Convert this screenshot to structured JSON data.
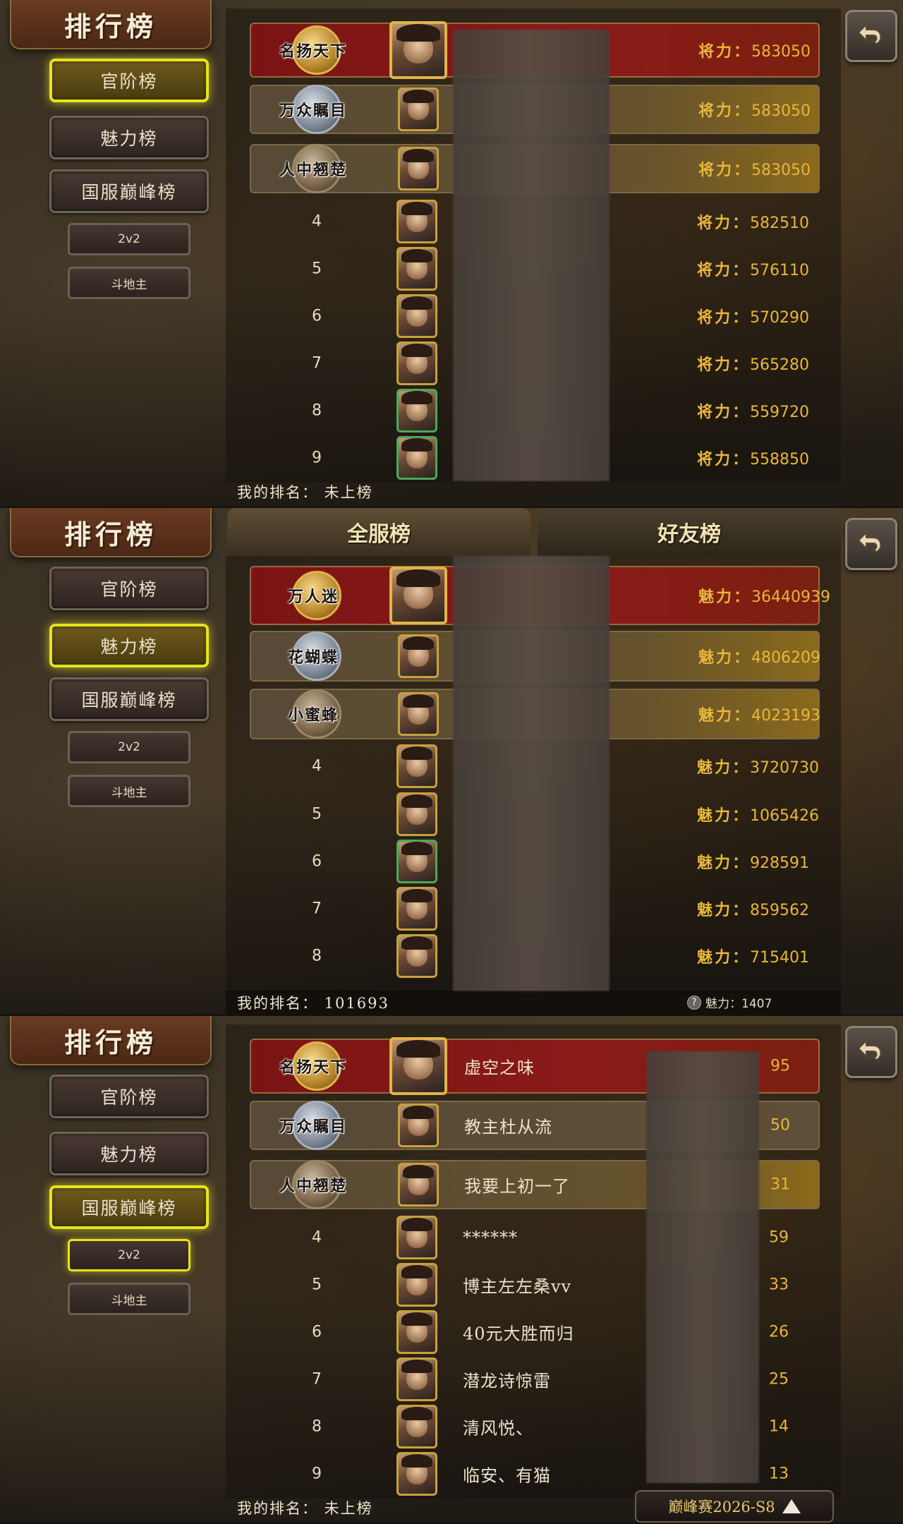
{
  "screen_title": "排行榜",
  "menu": {
    "official": "官阶榜",
    "charm": "魅力榜",
    "peak": "国服巅峰榜",
    "sub_2v2": "2v2",
    "sub_ddz": "斗地主"
  },
  "tabs": {
    "server": "全服榜",
    "friends": "好友榜"
  },
  "medal_labels": {
    "first": "名扬天下",
    "second": "万众瞩目",
    "third": "人中翘楚"
  },
  "charm_medal_labels": {
    "first": "万人迷",
    "second": "花蝴蝶",
    "third": "小蜜蜂"
  },
  "panel1": {
    "score_label": "将力：",
    "rows": [
      {
        "rank": "1",
        "score": "583050"
      },
      {
        "rank": "2",
        "score": "583050"
      },
      {
        "rank": "3",
        "score": "583050"
      },
      {
        "rank": "4",
        "score": "582510"
      },
      {
        "rank": "5",
        "score": "576110"
      },
      {
        "rank": "6",
        "score": "570290"
      },
      {
        "rank": "7",
        "score": "565280"
      },
      {
        "rank": "8",
        "score": "559720"
      },
      {
        "rank": "9",
        "score": "558850"
      }
    ],
    "my_rank": "我的排名： 未上榜"
  },
  "panel2": {
    "score_label": "魅力：",
    "rows": [
      {
        "rank": "1",
        "score": "36440939"
      },
      {
        "rank": "2",
        "score": "4806209"
      },
      {
        "rank": "3",
        "score": "4023193"
      },
      {
        "rank": "4",
        "score": "3720730"
      },
      {
        "rank": "5",
        "score": "1065426"
      },
      {
        "rank": "6",
        "score": "928591"
      },
      {
        "rank": "7",
        "score": "859562"
      },
      {
        "rank": "8",
        "score": "715401"
      }
    ],
    "my_rank": "我的排名： 101693",
    "my_charm": "魅力：1407"
  },
  "panel3": {
    "rows": [
      {
        "rank": "1",
        "name": "虚空之味",
        "score_tail": "95"
      },
      {
        "rank": "2",
        "name": "教主杜从流",
        "score_tail": "50"
      },
      {
        "rank": "3",
        "name": "我要上初一了",
        "score_tail": "31"
      },
      {
        "rank": "4",
        "name": "******",
        "score_tail": "59"
      },
      {
        "rank": "5",
        "name": "博主左左桑vv",
        "score_tail": "33"
      },
      {
        "rank": "6",
        "name": "40元大胜而归",
        "score_tail": "26"
      },
      {
        "rank": "7",
        "name": "潜龙诗惊雷",
        "score_tail": "25"
      },
      {
        "rank": "8",
        "name": "清风悦、",
        "score_tail": "14"
      },
      {
        "rank": "9",
        "name": "临安、有猫",
        "score_tail": "13"
      }
    ],
    "my_rank": "我的排名： 未上榜",
    "season": "巅峰赛2026-S8"
  },
  "icons": {
    "back": "back-arrow-icon",
    "help": "question-icon",
    "expand": "triangle-up-icon"
  },
  "colors": {
    "active_border": "#e8e21c",
    "score_gold": "#e8b63a",
    "first_row": "#7a1414"
  }
}
